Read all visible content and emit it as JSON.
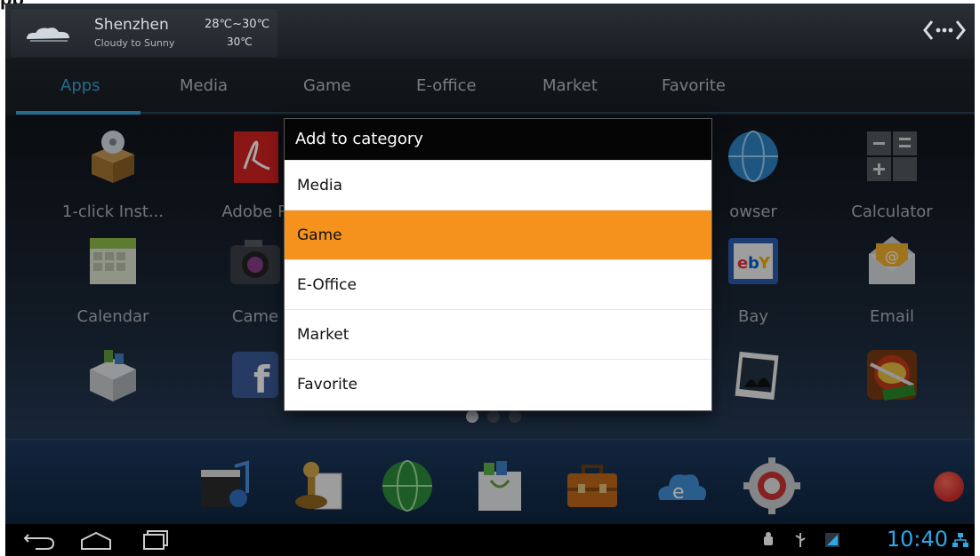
{
  "header_label": "pp",
  "weather": {
    "city": "Shenzhen",
    "condition": "Cloudy to Sunny",
    "range": "28℃~30℃",
    "current": "30℃"
  },
  "tabs": [
    {
      "label": "Apps",
      "active": true
    },
    {
      "label": "Media",
      "active": false
    },
    {
      "label": "Game",
      "active": false
    },
    {
      "label": "E-office",
      "active": false
    },
    {
      "label": "Market",
      "active": false
    },
    {
      "label": "Favorite",
      "active": false
    }
  ],
  "apps": [
    {
      "label": "1-click Inst...",
      "icon": "installer-box-icon"
    },
    {
      "label": "Adobe R",
      "icon": "adobe-reader-icon"
    },
    {
      "label": "",
      "icon": "hidden-app-icon"
    },
    {
      "label": "",
      "icon": "hidden-app-icon"
    },
    {
      "label": "owser",
      "icon": "browser-globe-icon"
    },
    {
      "label": "Calculator",
      "icon": "calculator-icon"
    },
    {
      "label": "Calendar",
      "icon": "calendar-icon"
    },
    {
      "label": "Came",
      "icon": "camera-icon"
    },
    {
      "label": "",
      "icon": "hidden-app-icon"
    },
    {
      "label": "",
      "icon": "hidden-app-icon"
    },
    {
      "label": "Bay",
      "icon": "ebay-icon"
    },
    {
      "label": "Email",
      "icon": "email-icon"
    },
    {
      "label": "",
      "icon": "app-store-box-icon"
    },
    {
      "label": "",
      "icon": "facebook-icon"
    },
    {
      "label": "",
      "icon": "hidden-app-icon"
    },
    {
      "label": "",
      "icon": "hidden-app-icon"
    },
    {
      "label": "",
      "icon": "gallery-icon"
    },
    {
      "label": "",
      "icon": "fruit-ninja-icon"
    }
  ],
  "page_indicator": {
    "current": 1,
    "total": 3
  },
  "dock": [
    "media-icon",
    "game-icon",
    "globe-icon",
    "market-bag-icon",
    "briefcase-icon",
    "cloud-browser-icon",
    "settings-gear-icon"
  ],
  "dialog": {
    "title": "Add to category",
    "options": [
      {
        "label": "Media",
        "selected": false
      },
      {
        "label": "Game",
        "selected": true
      },
      {
        "label": "E-Office",
        "selected": false
      },
      {
        "label": "Market",
        "selected": false
      },
      {
        "label": "Favorite",
        "selected": false
      }
    ]
  },
  "status": {
    "time": "10:40"
  },
  "colors": {
    "accent": "#3aa5d9",
    "selected": "#f5921e",
    "clock": "#2ea7e6"
  }
}
